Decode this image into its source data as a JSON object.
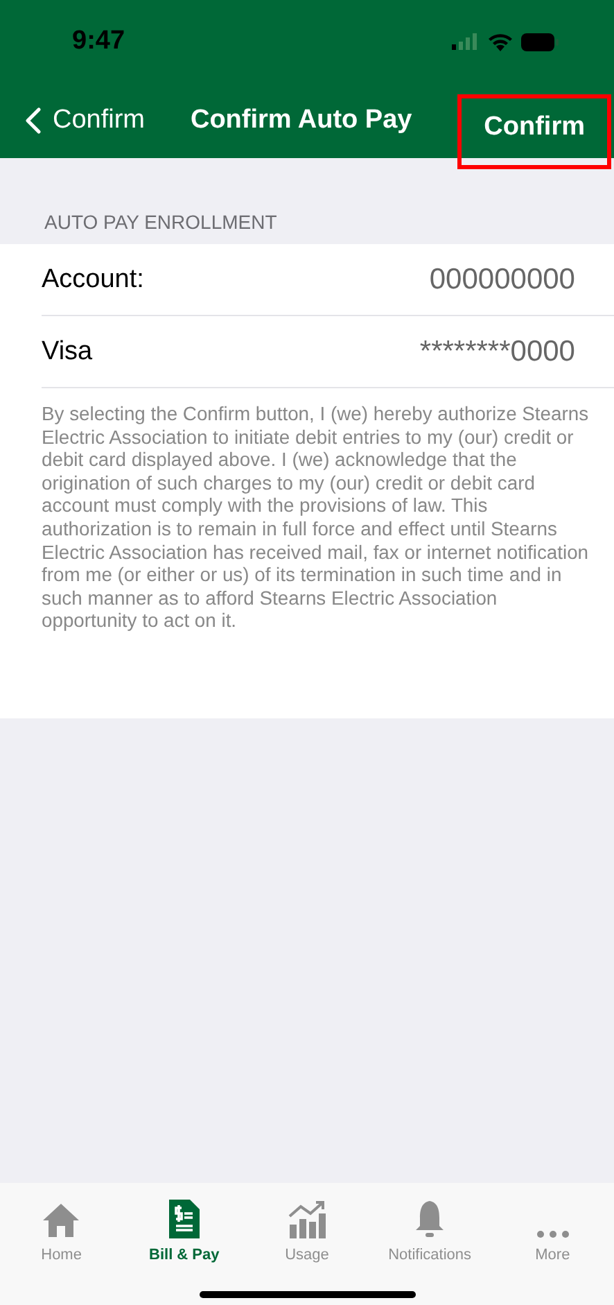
{
  "status_bar": {
    "time": "9:47"
  },
  "nav": {
    "back_label": "Confirm",
    "title": "Confirm Auto Pay",
    "action": {
      "label": "Confirm",
      "highlighted": true
    }
  },
  "section": {
    "header": "AUTO PAY ENROLLMENT",
    "rows": [
      {
        "label": "Account:",
        "value": "000000000"
      },
      {
        "label": "Visa",
        "value": "********0000"
      }
    ],
    "disclaimer": "By selecting the Confirm button, I (we) hereby authorize Stearns Electric Association to initiate debit entries to my (our) credit or debit card displayed above. I (we) acknowledge that the origination of such charges to my (our) credit or debit card account must comply with the provisions of law. This authorization is to remain in full force and effect until Stearns Electric Association has received mail, fax or internet notification from me (or either or us) of its termination in such time and in such manner as to afford Stearns Electric Association opportunity to act on it."
  },
  "tabs": [
    {
      "label": "Home",
      "kind": "home",
      "selected": false
    },
    {
      "label": "Bill & Pay",
      "kind": "bill",
      "selected": true
    },
    {
      "label": "Usage",
      "kind": "usage",
      "selected": false
    },
    {
      "label": "Notifications",
      "kind": "bell",
      "selected": false
    },
    {
      "label": "More",
      "kind": "more",
      "selected": false
    }
  ]
}
